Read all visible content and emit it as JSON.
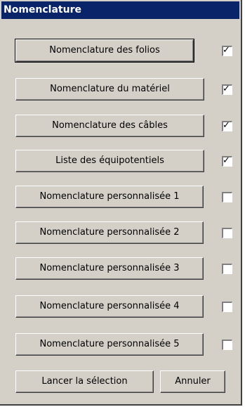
{
  "window": {
    "title": "Nomenclature"
  },
  "items": [
    {
      "label": "Nomenclature des folios",
      "checked": true
    },
    {
      "label": "Nomenclature du matériel",
      "checked": true
    },
    {
      "label": "Nomenclature des câbles",
      "checked": true
    },
    {
      "label": "Liste des équipotentiels",
      "checked": true
    },
    {
      "label": "Nomenclature personnalisée 1",
      "checked": false
    },
    {
      "label": "Nomenclature personnalisée 2",
      "checked": false
    },
    {
      "label": "Nomenclature personnalisée 3",
      "checked": false
    },
    {
      "label": "Nomenclature personnalisée 4",
      "checked": false
    },
    {
      "label": "Nomenclature personnalisée 5",
      "checked": false
    }
  ],
  "footer": {
    "run_label": "Lancer la sélection",
    "cancel_label": "Annuler"
  },
  "colors": {
    "title_bg": "#0a246a",
    "face": "#d4d0c8"
  }
}
